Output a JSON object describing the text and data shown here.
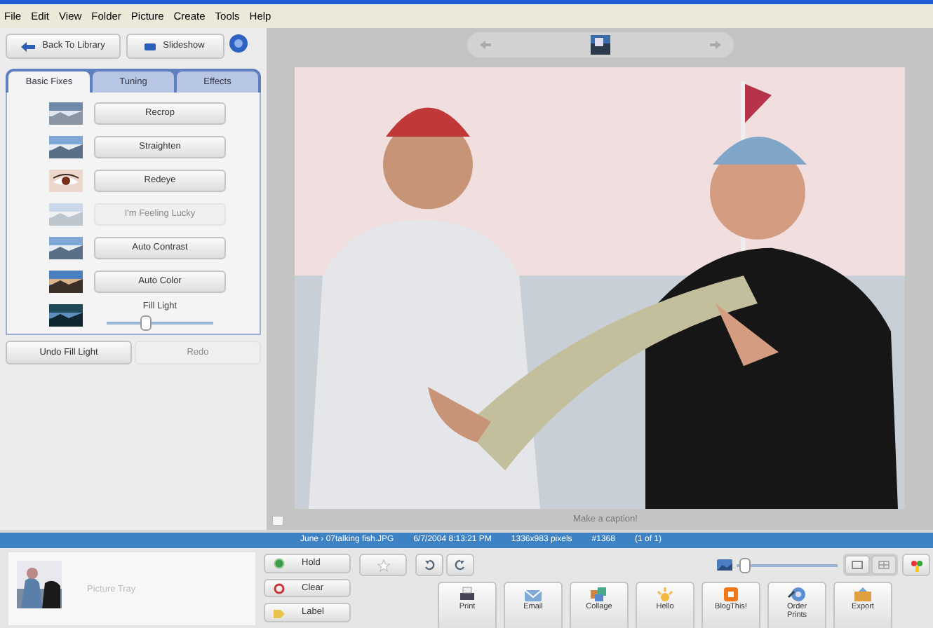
{
  "menu": [
    "File",
    "Edit",
    "View",
    "Folder",
    "Picture",
    "Create",
    "Tools",
    "Help"
  ],
  "top_buttons": [
    {
      "label": "Back To Library",
      "kind": "back"
    },
    {
      "label": "Slideshow",
      "kind": "slideshow"
    },
    {
      "kind": "help"
    }
  ],
  "tabs": [
    {
      "label": "Basic Fixes",
      "selected": true
    },
    {
      "label": "Tuning",
      "selected": false
    },
    {
      "label": "Effects",
      "selected": false
    }
  ],
  "fixes": [
    {
      "kind": "button",
      "label": "Recrop",
      "disabled": false
    },
    {
      "kind": "button",
      "label": "Straighten",
      "disabled": false
    },
    {
      "kind": "button",
      "label": "Redeye",
      "disabled": false
    },
    {
      "kind": "button",
      "label": "I'm Feeling Lucky",
      "disabled": true
    },
    {
      "kind": "button",
      "label": "Auto Contrast",
      "disabled": false
    },
    {
      "kind": "button",
      "label": "Auto Color",
      "disabled": false
    },
    {
      "kind": "slider",
      "label": "Fill Light",
      "level": 0.35
    }
  ],
  "undo_buttons": [
    {
      "label": "Undo Fill Light",
      "disabled": false
    },
    {
      "label": "Redo",
      "disabled": true
    }
  ],
  "caption": {
    "placeholder": "Make a caption!"
  },
  "status_bar": [
    "June › 07talking fish.JPG",
    "6/7/2004 8:13:21 PM",
    "1336x983 pixels",
    "#1368",
    "(1 of 1)"
  ],
  "tray": {
    "label": "Picture Tray",
    "buttons": [
      {
        "label": "Hold",
        "kind": "hold"
      },
      {
        "label": "Clear",
        "kind": "clear"
      },
      {
        "label": "Label",
        "kind": "label"
      }
    ]
  },
  "zoom": {
    "level": 0.02
  },
  "actions": [
    {
      "label": "Print",
      "kind": "print"
    },
    {
      "label": "Email",
      "kind": "email"
    },
    {
      "label": "Collage",
      "kind": "collage"
    },
    {
      "label": "Hello",
      "kind": "hello"
    },
    {
      "label": "BlogThis!",
      "kind": "blog"
    },
    {
      "label": "Order Prints",
      "kind": "order"
    },
    {
      "label": "Export",
      "kind": "export"
    }
  ]
}
